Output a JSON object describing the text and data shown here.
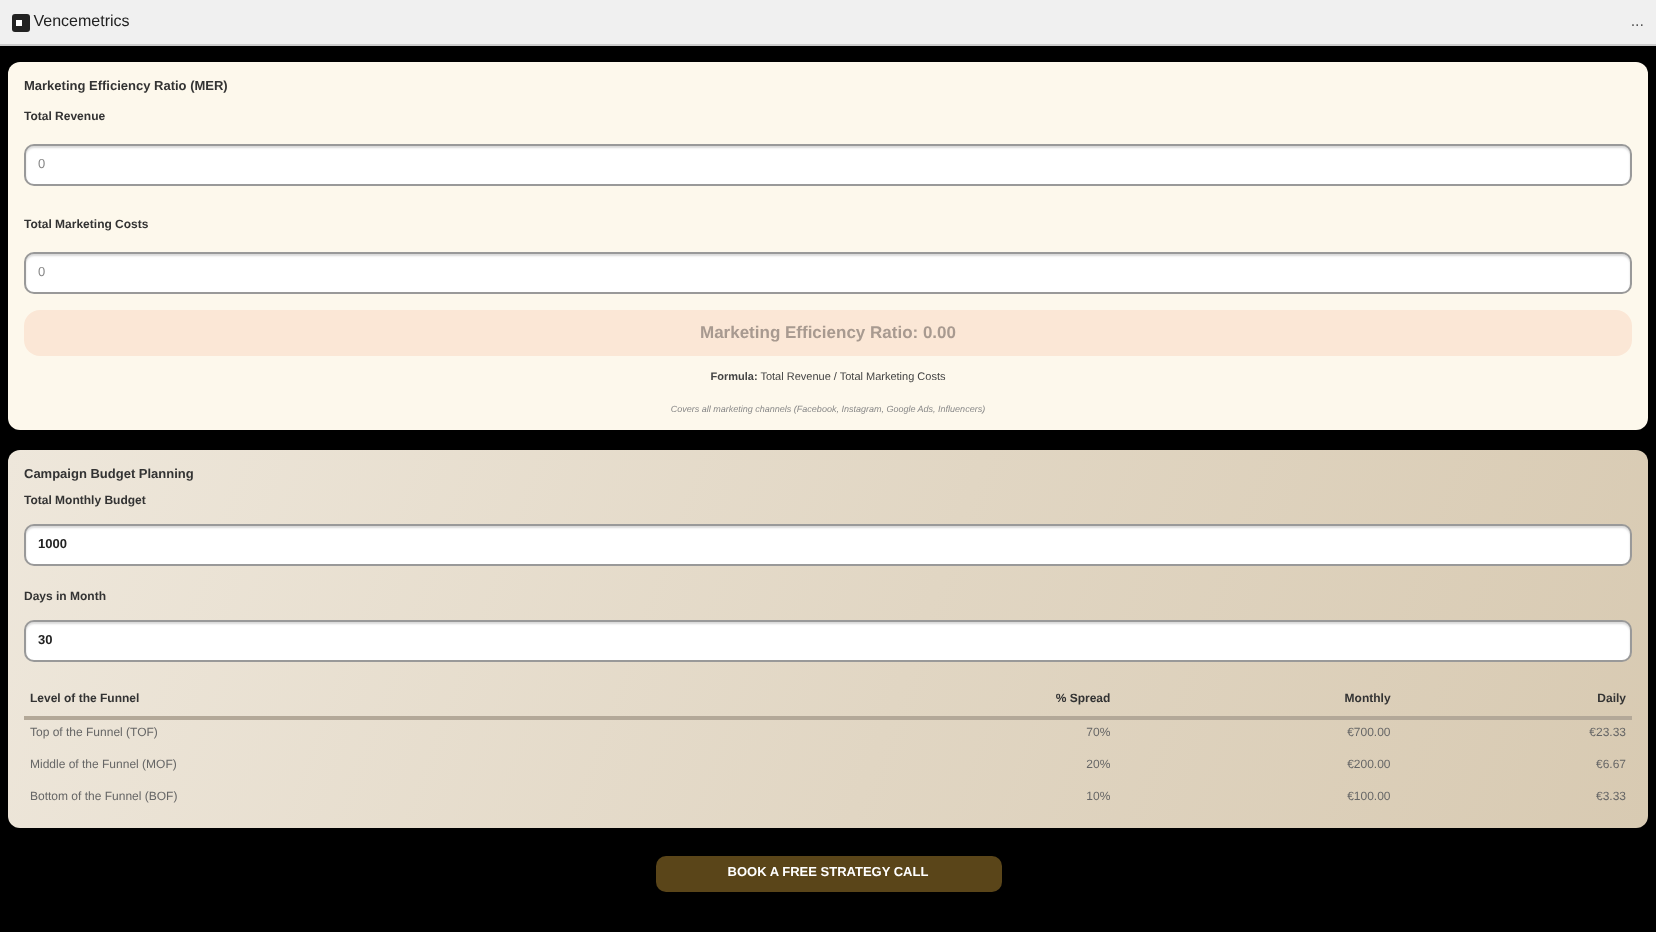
{
  "app_bar": {
    "title": "Vencemetrics",
    "menu": "..."
  },
  "mer": {
    "title": "Marketing Efficiency Ratio (MER)",
    "fields": [
      {
        "label": "Total Revenue",
        "placeholder": "0"
      },
      {
        "label": "Total Marketing Costs",
        "placeholder": "0"
      }
    ],
    "result": "Marketing Efficiency Ratio: 0.00",
    "formula": "**Formula:** Total Revenue / Total Marketing Costs",
    "note": "Covers all marketing channels (Facebook, Instagram, Google Ads, Influencers)"
  },
  "budget": {
    "title": "Campaign Budget Planning",
    "fields": [
      {
        "label": "Total Monthly Budget",
        "value": "1000"
      },
      {
        "label": "Days in Month",
        "value": "30"
      }
    ],
    "table": {
      "columns": [
        "Level of the Funnel",
        "% Spread",
        "Monthly",
        "Daily"
      ],
      "rows": [
        [
          "Top of the Funnel (TOF)",
          "70%",
          "€700.00",
          "€23.33"
        ],
        [
          "Middle of the Funnel (MOF)",
          "20%",
          "€200.00",
          "€6.67"
        ],
        [
          "Bottom of the Funnel (BOF)",
          "10%",
          "€100.00",
          "€3.33"
        ]
      ]
    }
  },
  "cta": "BOOK A FREE STRATEGY CALL"
}
